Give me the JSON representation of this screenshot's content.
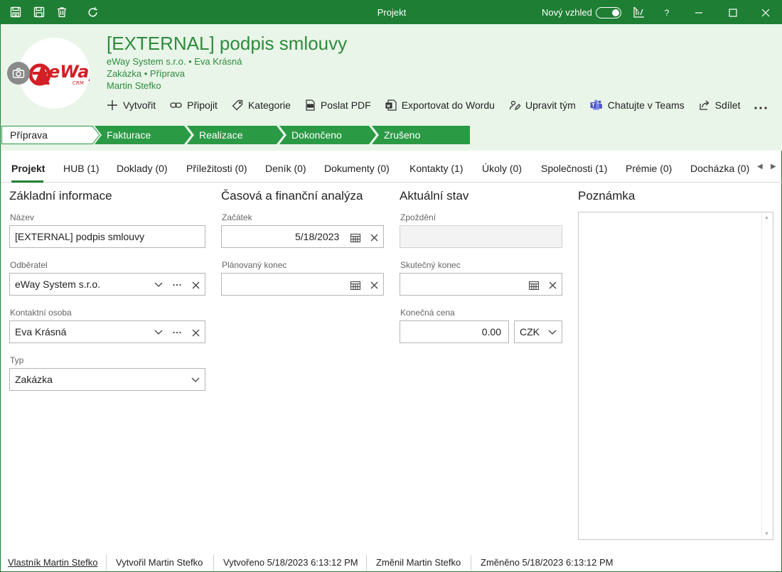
{
  "window": {
    "title": "Projekt",
    "new_look_label": "Nový vzhled",
    "help_label": "?"
  },
  "header": {
    "record_title": "[EXTERNAL] podpis smlouvy",
    "subtitle_line1": "eWay System s.r.o. • Eva Krásná",
    "subtitle_line2": "Zakázka • Příprava",
    "subtitle_line3": "Martin Stefko",
    "logo_text": "eWay",
    "logo_subtext": "CRM"
  },
  "toolbar": {
    "create": "Vytvořit",
    "attach": "Připojit",
    "category": "Kategorie",
    "send_pdf": "Poslat PDF",
    "export_word": "Exportovat do Wordu",
    "edit_team": "Upravit tým",
    "teams_chat": "Chatujte v Teams",
    "share": "Sdílet"
  },
  "stages": [
    "Příprava",
    "Fakturace",
    "Realizace",
    "Dokončeno",
    "Zrušeno"
  ],
  "tabs": [
    "Projekt",
    "HUB (1)",
    "Doklady (0)",
    "Příležitosti (0)",
    "Deník (0)",
    "Dokumenty (0)",
    "Kontakty (1)",
    "Úkoly (0)",
    "Společnosti (1)",
    "Prémie (0)",
    "Docházka (0)"
  ],
  "sections": {
    "basic": "Základní informace",
    "time_finance": "Časová a finanční analýza",
    "current_state": "Aktuální stav",
    "note": "Poznámka"
  },
  "basic": {
    "name_label": "Název",
    "name_value": "[EXTERNAL] podpis smlouvy",
    "customer_label": "Odběratel",
    "customer_value": "eWay System s.r.o.",
    "contact_label": "Kontaktní osoba",
    "contact_value": "Eva Krásná",
    "type_label": "Typ",
    "type_value": "Zakázka"
  },
  "time": {
    "start_label": "Začátek",
    "start_value": "5/18/2023",
    "planned_end_label": "Plánovaný konec",
    "planned_end_value": ""
  },
  "state": {
    "delay_label": "Zpoždění",
    "delay_value": "",
    "actual_end_label": "Skutečný konec",
    "actual_end_value": "",
    "final_price_label": "Konečná cena",
    "final_price_value": "0.00",
    "currency_value": "CZK"
  },
  "footer": {
    "owner": "Vlastník Martin Stefko",
    "created_by": "Vytvořil Martin Stefko",
    "created_at": "Vytvořeno 5/18/2023 6:13:12 PM",
    "changed_by": "Změnil Martin Stefko",
    "changed_at": "Změněno 5/18/2023 6:13:12 PM"
  },
  "colors": {
    "brand_green": "#1e7f34",
    "header_bg": "#e9f5e9",
    "title_green": "#2e8b3c",
    "stage_active": "#ffffff",
    "stage_inactive": "#2a9a45"
  }
}
